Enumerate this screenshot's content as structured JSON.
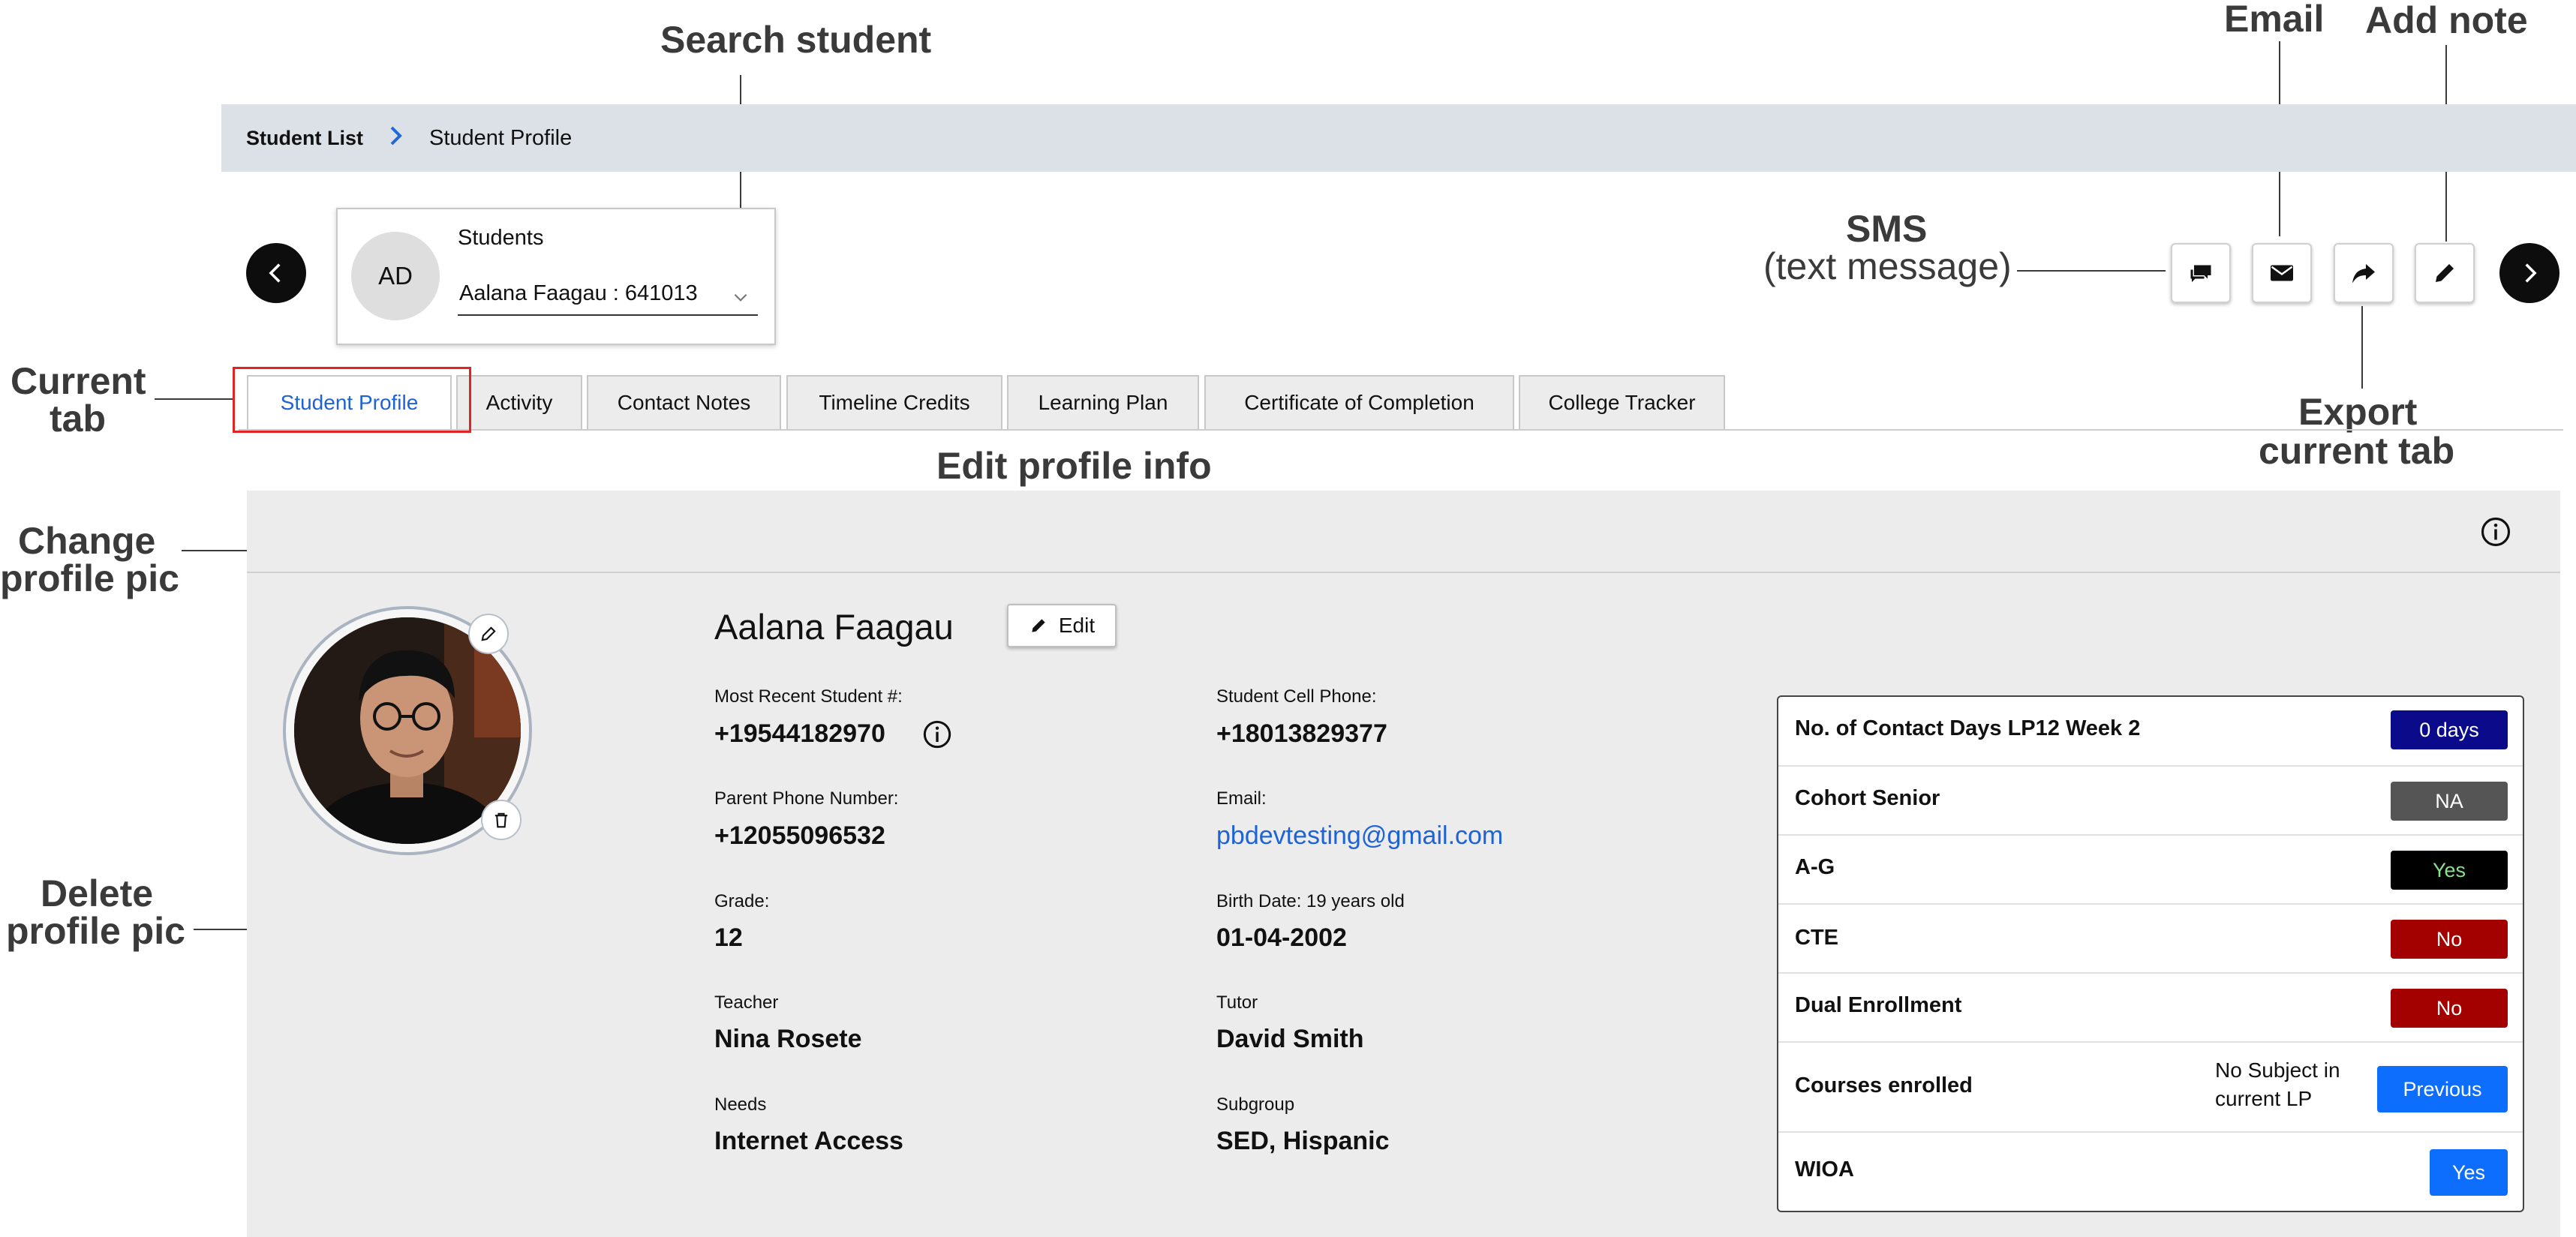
{
  "callouts": {
    "search_student": "Search student",
    "email": "Email",
    "add_note": "Add note",
    "sms": "SMS",
    "sms_sub": "(text message)",
    "export_1": "Export",
    "export_2": "current tab",
    "current_tab_1": "Current",
    "current_tab_2": "tab",
    "edit_profile": "Edit profile info",
    "change_pic_1": "Change",
    "change_pic_2": "profile pic",
    "delete_pic_1": "Delete",
    "delete_pic_2": "profile pic"
  },
  "breadcrumb": {
    "root": "Student List",
    "current": "Student Profile"
  },
  "student_selector": {
    "initials": "AD",
    "label": "Students",
    "value": "Aalana Faagau : 641013"
  },
  "tabs": [
    {
      "label": "Student Profile",
      "active": true
    },
    {
      "label": "Activity"
    },
    {
      "label": "Contact Notes"
    },
    {
      "label": "Timeline Credits"
    },
    {
      "label": "Learning Plan"
    },
    {
      "label": "Certificate of Completion"
    },
    {
      "label": "College Tracker"
    }
  ],
  "profile": {
    "name": "Aalana Faagau",
    "edit_label": "Edit",
    "fields": {
      "student_num_label": "Most Recent Student #:",
      "student_num": "+19544182970",
      "cell_label": "Student Cell Phone:",
      "cell": "+18013829377",
      "parent_label": "Parent Phone Number:",
      "parent": "+12055096532",
      "email_label": "Email:",
      "email": "pbdevtesting@gmail.com",
      "grade_label": "Grade:",
      "grade": "12",
      "birth_label": "Birth Date: 19 years old",
      "birth": "01-04-2002",
      "teacher_label": "Teacher",
      "teacher": "Nina Rosete",
      "tutor_label": "Tutor",
      "tutor": "David Smith",
      "needs_label": "Needs",
      "needs": "Internet Access",
      "subgroup_label": "Subgroup",
      "subgroup": "SED, Hispanic"
    }
  },
  "status": [
    {
      "label": "No. of Contact Days LP12 Week 2",
      "value": "0 days",
      "color": "#0a0a8a"
    },
    {
      "label": "Cohort Senior",
      "value": "NA",
      "color": "#555555"
    },
    {
      "label": "A-G",
      "value": "Yes",
      "color": "#000000",
      "text_color": "#8be08b"
    },
    {
      "label": "CTE",
      "value": "No",
      "color": "#a30000"
    },
    {
      "label": "Dual Enrollment",
      "value": "No",
      "color": "#a30000"
    },
    {
      "label": "Courses enrolled",
      "note_1": "No Subject in",
      "note_2": "current LP",
      "value": "Previous",
      "color": "#0d6efd"
    },
    {
      "label": "WIOA",
      "value": "Yes",
      "color": "#0d6efd"
    }
  ]
}
